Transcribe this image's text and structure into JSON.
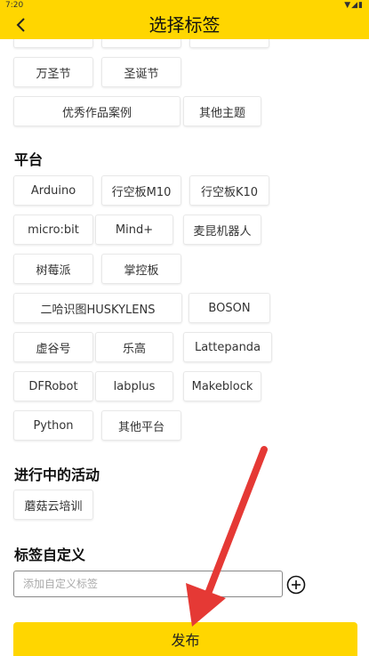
{
  "status_bar": {
    "time": "7:20",
    "icons": "▼◢▮"
  },
  "header": {
    "back_icon": "chevron-left-icon",
    "title": "选择标签"
  },
  "top_tags": {
    "row1": [
      "万圣节",
      "圣诞节"
    ],
    "row2": [
      "优秀作品案例",
      "其他主题"
    ]
  },
  "platform": {
    "title": "平台",
    "tags": [
      "Arduino",
      "行空板M10",
      "行空板K10",
      "micro:bit",
      "Mind+",
      "麦昆机器人",
      "树莓派",
      "掌控板",
      "二哈识图HUSKYLENS",
      "BOSON",
      "虚谷号",
      "乐高",
      "Lattepanda",
      "DFRobot",
      "labplus",
      "Makeblock",
      "Python",
      "其他平台"
    ]
  },
  "activity": {
    "title": "进行中的活动",
    "tags": [
      "蘑菇云培训"
    ]
  },
  "custom": {
    "title": "标签自定义",
    "placeholder": "添加自定义标签",
    "add_icon": "plus-circle-icon"
  },
  "publish_label": "发布",
  "colors": {
    "accent": "#FFD600",
    "arrow": "#E53935"
  }
}
